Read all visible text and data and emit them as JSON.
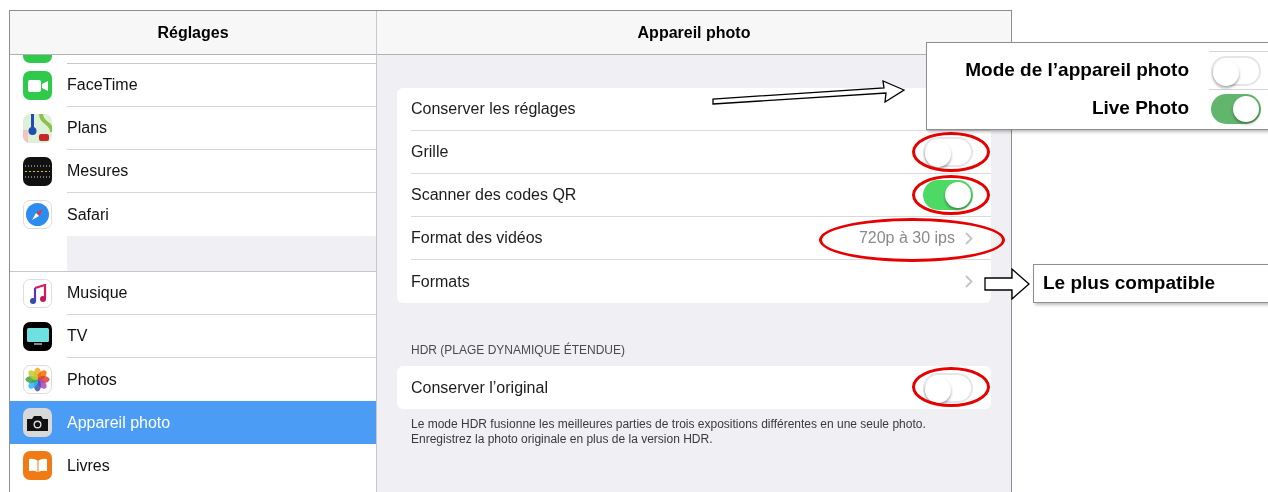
{
  "sidebar": {
    "title": "Réglages",
    "groups": [
      {
        "items": [
          {
            "label": "FaceTime",
            "selected": false
          },
          {
            "label": "Plans",
            "selected": false
          },
          {
            "label": "Mesures",
            "selected": false
          },
          {
            "label": "Safari",
            "selected": false
          }
        ]
      },
      {
        "items": [
          {
            "label": "Musique",
            "selected": false
          },
          {
            "label": "TV",
            "selected": false
          },
          {
            "label": "Photos",
            "selected": false
          },
          {
            "label": "Appareil photo",
            "selected": true
          },
          {
            "label": "Livres",
            "selected": false
          }
        ]
      }
    ]
  },
  "detail": {
    "title": "Appareil photo",
    "rows": [
      {
        "kind": "plain",
        "label": "Conserver les réglages",
        "circled": false
      },
      {
        "kind": "toggle",
        "label": "Grille",
        "on": false,
        "circled": true
      },
      {
        "kind": "toggle",
        "label": "Scanner des codes QR",
        "on": true,
        "circled": true
      },
      {
        "kind": "link",
        "label": "Format des vidéos",
        "value": "720p à 30 ips",
        "circled": true
      },
      {
        "kind": "link",
        "label": "Formats",
        "circled": false
      }
    ],
    "hdr": {
      "header": "HDR (PLAGE DYNAMIQUE ÉTENDUE)",
      "rows": [
        {
          "kind": "toggle",
          "label": "Conserver l’original",
          "on": false,
          "circled": true
        }
      ],
      "footnote": "Le mode HDR fusionne les meilleures parties de trois expositions différentes en une seule photo. Enregistrez la photo originale en plus de la version HDR."
    }
  },
  "annotations": {
    "callout_top": {
      "rows": [
        {
          "label": "Mode de l’appareil photo",
          "on": false
        },
        {
          "label": "Live Photo",
          "on": true
        }
      ]
    },
    "callout_formats": {
      "text": "Le plus compatible"
    }
  }
}
